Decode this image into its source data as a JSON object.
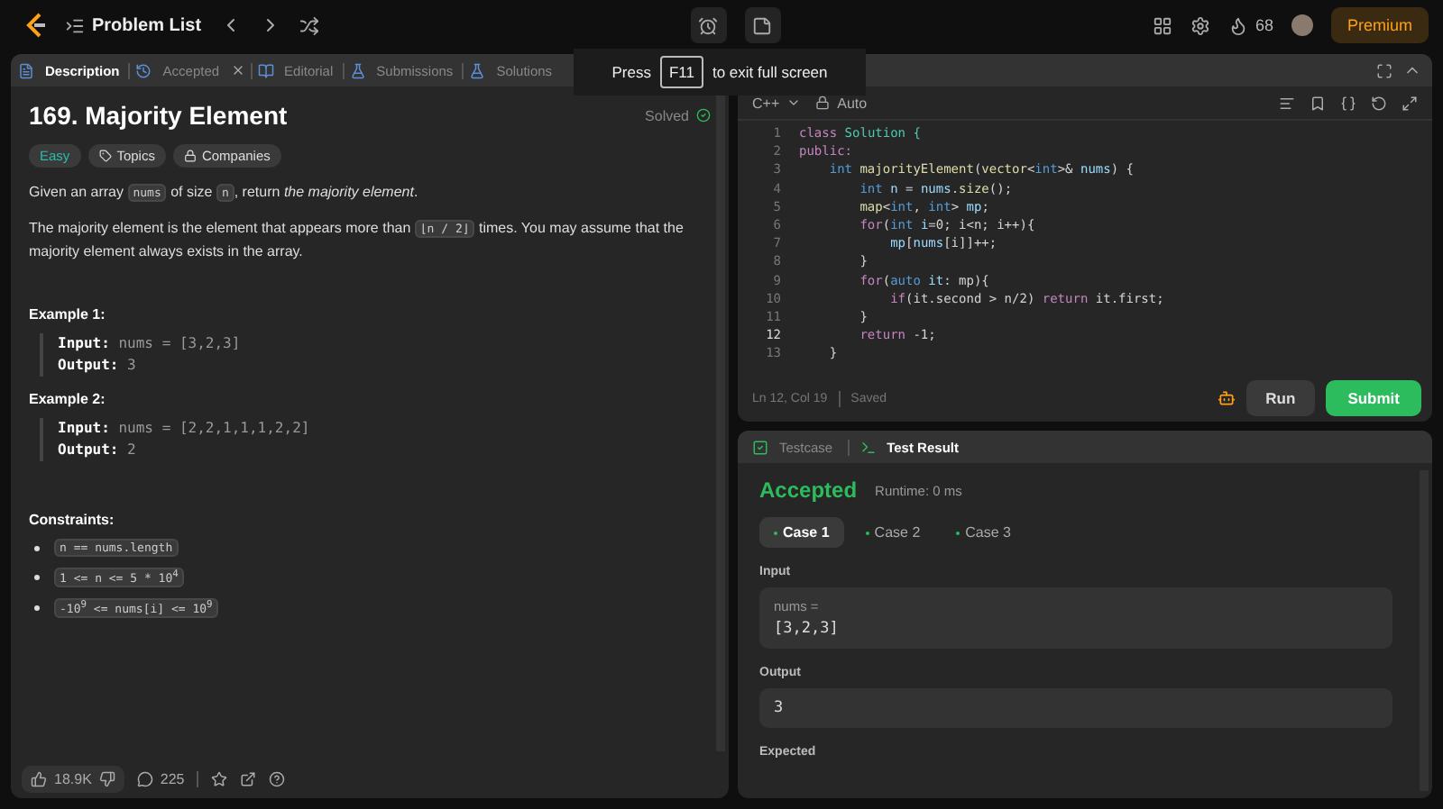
{
  "topbar": {
    "title": "Problem List",
    "streak": "68",
    "premium": "Premium"
  },
  "overlay": {
    "before": "Press",
    "key": "F11",
    "after": "to exit full screen"
  },
  "tabs": [
    {
      "label": "Description",
      "selected": true,
      "closable": false
    },
    {
      "label": "Accepted",
      "selected": false,
      "closable": true
    },
    {
      "label": "Editorial",
      "selected": false,
      "closable": false
    },
    {
      "label": "Submissions",
      "selected": false,
      "closable": false
    },
    {
      "label": "Solutions",
      "selected": false,
      "closable": false
    }
  ],
  "problem": {
    "title": "169. Majority Element",
    "status": "Solved",
    "difficulty": "Easy",
    "chips": [
      "Topics",
      "Companies"
    ],
    "paragraphs": [
      [
        {
          "kind": "text",
          "text": "Given an array "
        },
        {
          "kind": "code",
          "text": "nums"
        },
        {
          "kind": "text",
          "text": " of size "
        },
        {
          "kind": "code",
          "text": "n"
        },
        {
          "kind": "text",
          "text": ", return "
        },
        {
          "kind": "em",
          "text": "the majority element"
        },
        {
          "kind": "text",
          "text": "."
        }
      ],
      [
        {
          "kind": "text",
          "text": "The majority element is the element that appears more than "
        },
        {
          "kind": "code",
          "text": "⌊n / 2⌋"
        },
        {
          "kind": "text",
          "text": " times. You may assume that the majority element always exists in the array."
        }
      ]
    ],
    "examples": [
      {
        "title": "Example 1:",
        "input_label": "Input:",
        "input": "nums = [3,2,3]",
        "output_label": "Output:",
        "output": "3"
      },
      {
        "title": "Example 2:",
        "input_label": "Input:",
        "input": "nums = [2,2,1,1,1,2,2]",
        "output_label": "Output:",
        "output": "2"
      }
    ],
    "constraints_title": "Constraints:",
    "constraints": [
      "n == nums.length",
      "1 <= n <= 5 * 10$^{4}$",
      "-10$^{9}$ <= nums[i] <= 10$^{9}$"
    ]
  },
  "footer": {
    "likes": "18.9K",
    "comments": "225"
  },
  "editor": {
    "language": "C++",
    "mode": "Auto",
    "position": "Ln 12, Col 19",
    "saved": "Saved",
    "run": "Run",
    "submit": "Submit",
    "lines": [
      {
        "number": "1",
        "current": false,
        "tokens": [
          {
            "kind": "kw",
            "text": "class "
          },
          {
            "kind": "cls",
            "text": "Solution {"
          }
        ]
      },
      {
        "number": "2",
        "current": false,
        "tokens": [
          {
            "kind": "kw",
            "text": "public:"
          }
        ]
      },
      {
        "number": "3",
        "current": false,
        "tokens": [
          {
            "kind": "type",
            "text": "    int "
          },
          {
            "kind": "fn",
            "text": "majorityElement"
          },
          {
            "kind": "plain",
            "text": "("
          },
          {
            "kind": "fn",
            "text": "vector"
          },
          {
            "kind": "plain",
            "text": "<"
          },
          {
            "kind": "type",
            "text": "int"
          },
          {
            "kind": "plain",
            "text": ">& "
          },
          {
            "kind": "var",
            "text": "nums"
          },
          {
            "kind": "plain",
            "text": ") {"
          }
        ]
      },
      {
        "number": "4",
        "current": false,
        "tokens": [
          {
            "kind": "type",
            "text": "        int "
          },
          {
            "kind": "var",
            "text": "n"
          },
          {
            "kind": "plain",
            "text": " = "
          },
          {
            "kind": "var",
            "text": "nums"
          },
          {
            "kind": "plain",
            "text": "."
          },
          {
            "kind": "fn",
            "text": "size"
          },
          {
            "kind": "plain",
            "text": "();"
          }
        ]
      },
      {
        "number": "5",
        "current": false,
        "tokens": [
          {
            "kind": "fn",
            "text": "        map"
          },
          {
            "kind": "plain",
            "text": "<"
          },
          {
            "kind": "type",
            "text": "int"
          },
          {
            "kind": "plain",
            "text": ", "
          },
          {
            "kind": "type",
            "text": "int"
          },
          {
            "kind": "plain",
            "text": "> "
          },
          {
            "kind": "var",
            "text": "mp"
          },
          {
            "kind": "plain",
            "text": ";"
          }
        ]
      },
      {
        "number": "6",
        "current": false,
        "tokens": [
          {
            "kind": "kw",
            "text": "        for"
          },
          {
            "kind": "plain",
            "text": "("
          },
          {
            "kind": "type",
            "text": "int "
          },
          {
            "kind": "var",
            "text": "i"
          },
          {
            "kind": "plain",
            "text": "=0; i<n; i++){"
          }
        ]
      },
      {
        "number": "7",
        "current": false,
        "tokens": [
          {
            "kind": "var",
            "text": "            mp"
          },
          {
            "kind": "plain",
            "text": "["
          },
          {
            "kind": "var",
            "text": "nums"
          },
          {
            "kind": "plain",
            "text": "[i]]++;"
          }
        ]
      },
      {
        "number": "8",
        "current": false,
        "tokens": [
          {
            "kind": "plain",
            "text": "        }"
          }
        ]
      },
      {
        "number": "9",
        "current": false,
        "tokens": [
          {
            "kind": "kw",
            "text": "        for"
          },
          {
            "kind": "plain",
            "text": "("
          },
          {
            "kind": "type",
            "text": "auto "
          },
          {
            "kind": "var",
            "text": "it"
          },
          {
            "kind": "plain",
            "text": ": mp){"
          }
        ]
      },
      {
        "number": "10",
        "current": false,
        "tokens": [
          {
            "kind": "kw",
            "text": "            if"
          },
          {
            "kind": "plain",
            "text": "(it.second > n/2) "
          },
          {
            "kind": "kw",
            "text": "return "
          },
          {
            "kind": "plain",
            "text": "it.first;"
          }
        ]
      },
      {
        "number": "11",
        "current": false,
        "tokens": [
          {
            "kind": "plain",
            "text": "        }"
          }
        ]
      },
      {
        "number": "12",
        "current": true,
        "tokens": [
          {
            "kind": "kw",
            "text": "        return "
          },
          {
            "kind": "plain",
            "text": "-1;"
          }
        ]
      },
      {
        "number": "13",
        "current": false,
        "tokens": [
          {
            "kind": "plain",
            "text": "    }"
          }
        ]
      }
    ]
  },
  "result": {
    "tabs": [
      {
        "label": "Testcase",
        "selected": false
      },
      {
        "label": "Test Result",
        "selected": true
      }
    ],
    "verdict": "Accepted",
    "runtime": "Runtime: 0 ms",
    "cases": [
      {
        "label": "Case 1",
        "selected": true
      },
      {
        "label": "Case 2",
        "selected": false
      },
      {
        "label": "Case 3",
        "selected": false
      }
    ],
    "input_title": "Input",
    "input_name": "nums =",
    "input_value": "[3,2,3]",
    "output_title": "Output",
    "output_value": "3",
    "expected_title": "Expected"
  }
}
